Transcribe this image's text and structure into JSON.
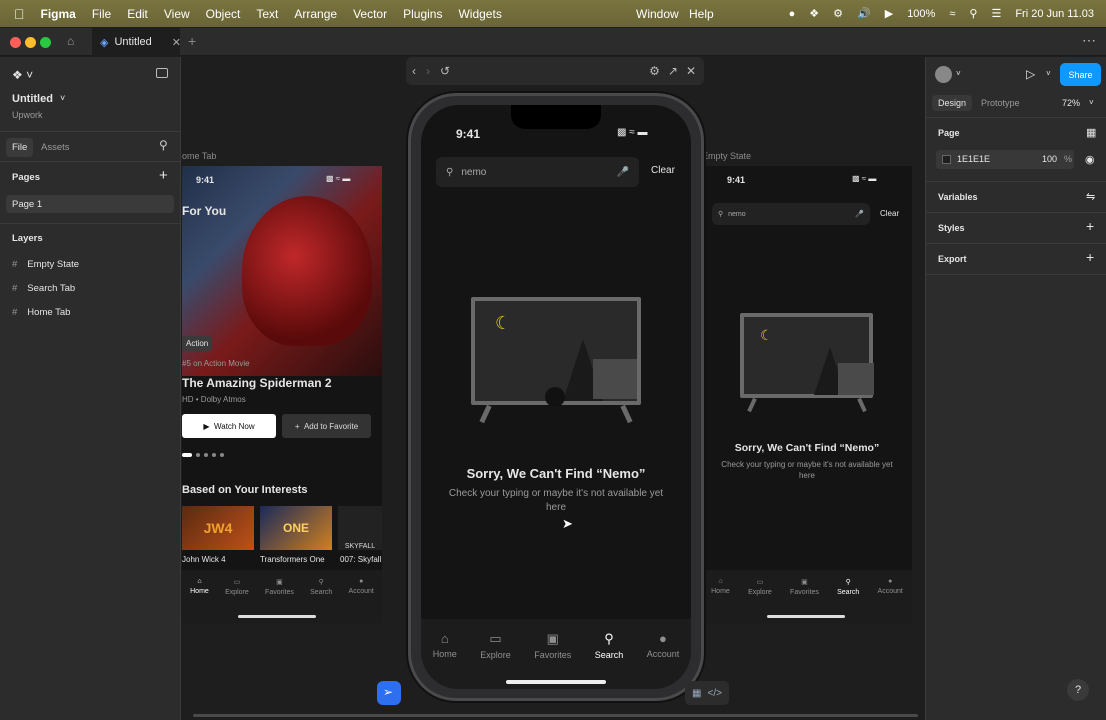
{
  "menubar": {
    "app": "Figma",
    "items": [
      "File",
      "Edit",
      "View",
      "Object",
      "Text",
      "Arrange",
      "Vector",
      "Plugins",
      "Widgets"
    ],
    "window": "Window",
    "help": "Help",
    "battery": "100%",
    "datetime": "Fri 20 Jun  11.03"
  },
  "tabbar": {
    "tab_title": "Untitled"
  },
  "left": {
    "file_title": "Untitled",
    "team": "Upwork",
    "tab_file": "File",
    "tab_assets": "Assets",
    "pages_label": "Pages",
    "page1": "Page 1",
    "layers_label": "Layers",
    "layers": [
      "Empty State",
      "Search Tab",
      "Home Tab"
    ]
  },
  "right": {
    "design": "Design",
    "prototype": "Prototype",
    "zoom": "72%",
    "share": "Share",
    "page_label": "Page",
    "bg_hex": "1E1E1E",
    "bg_opacity": "100",
    "percent": "%",
    "variables": "Variables",
    "styles": "Styles",
    "export": "Export",
    "bg_color": "#1e1e1e"
  },
  "canvas": {
    "label_home": "ome Tab",
    "label_empty": "Empty State",
    "home": {
      "time": "9:41",
      "for_you": "For You",
      "badge": "Action",
      "rank": "#5 on Action Movie",
      "title": "The Amazing Spiderman 2",
      "meta": "HD • Dolby Atmos",
      "watch": "Watch Now",
      "fav": "Add to Favorite",
      "section": "Based on Your Interests",
      "movies": [
        "John Wick 4",
        "Transformers One",
        "007: Skyfall"
      ],
      "poster_texts": [
        "JW4",
        "ONE",
        "SKYFALL"
      ]
    },
    "nav": [
      "Home",
      "Explore",
      "Favorites",
      "Search",
      "Account"
    ],
    "search": {
      "time": "9:41",
      "query": "nemo",
      "clear": "Clear",
      "heading": "Sorry, We Can't Find “Nemo”",
      "body": "Check your typing or maybe it's not available yet here"
    }
  }
}
